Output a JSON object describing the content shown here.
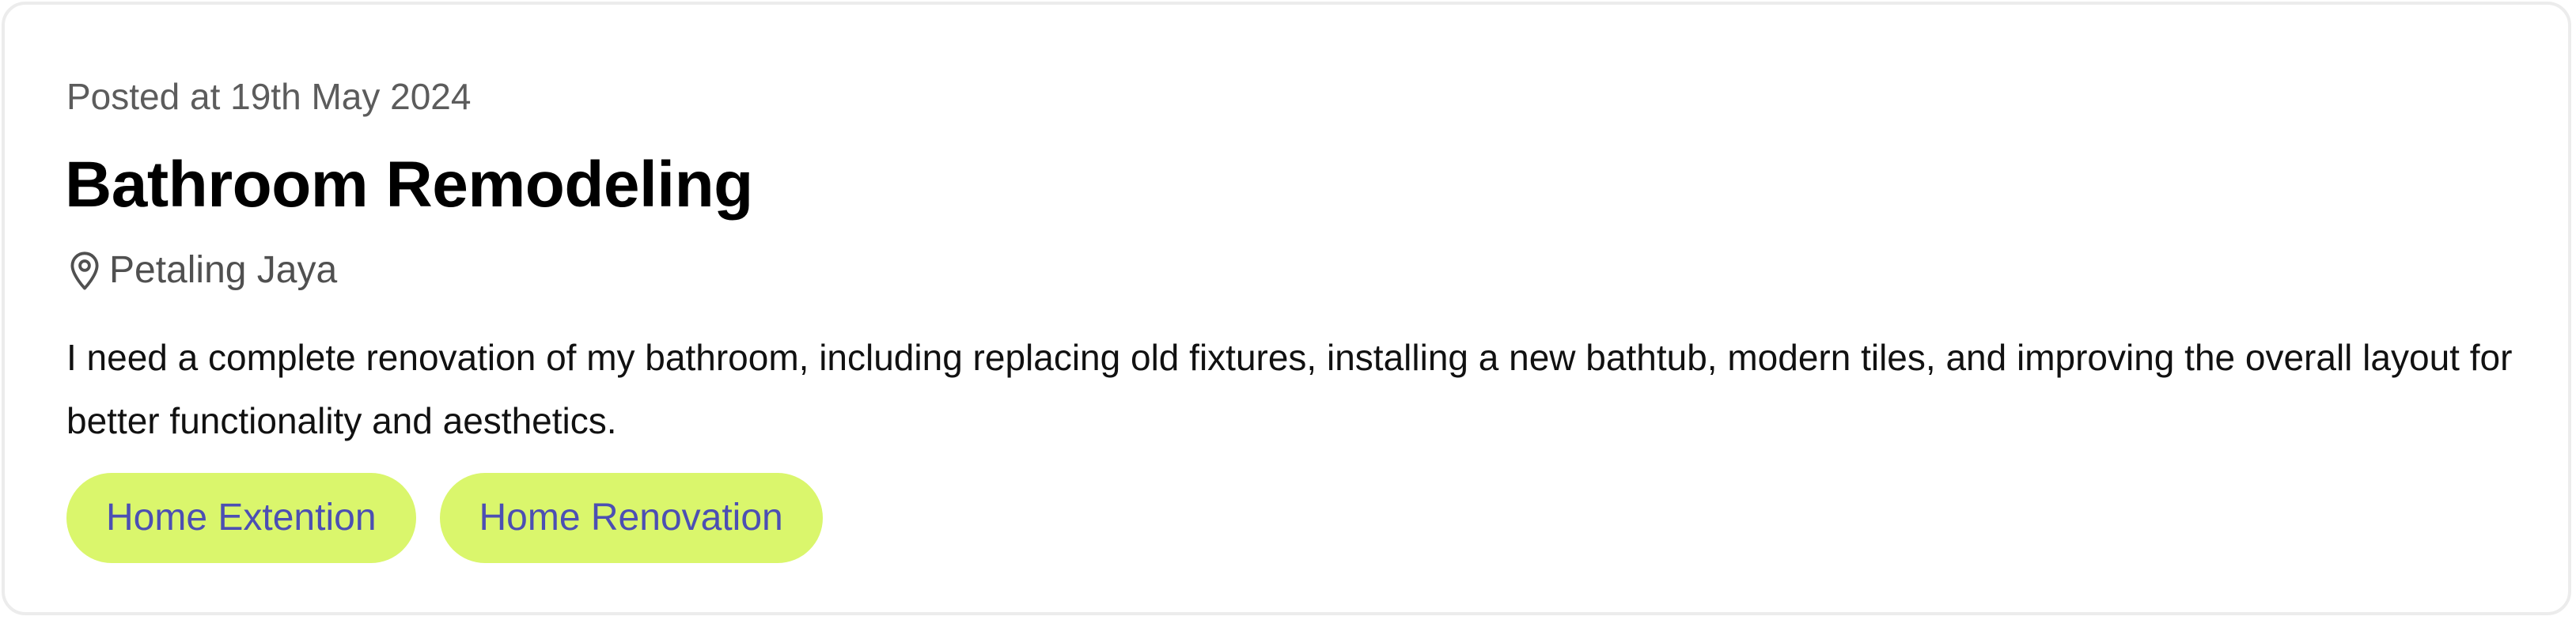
{
  "post": {
    "posted_at": "Posted at 19th May 2024",
    "title": "Bathroom Remodeling",
    "location_icon": "map-pin-icon",
    "location": "Petaling Jaya",
    "description": "I need a complete renovation of my bathroom, including replacing old fixtures, installing a new bathtub, modern tiles, and improving the overall layout for better functionality and aesthetics.",
    "tags": [
      {
        "label": "Home Extention"
      },
      {
        "label": "Home Renovation"
      }
    ]
  },
  "colors": {
    "tag_background": "#daf66c",
    "tag_text": "#4c4fb3",
    "card_border": "#ececec",
    "meta_text": "#5c5c5c"
  }
}
